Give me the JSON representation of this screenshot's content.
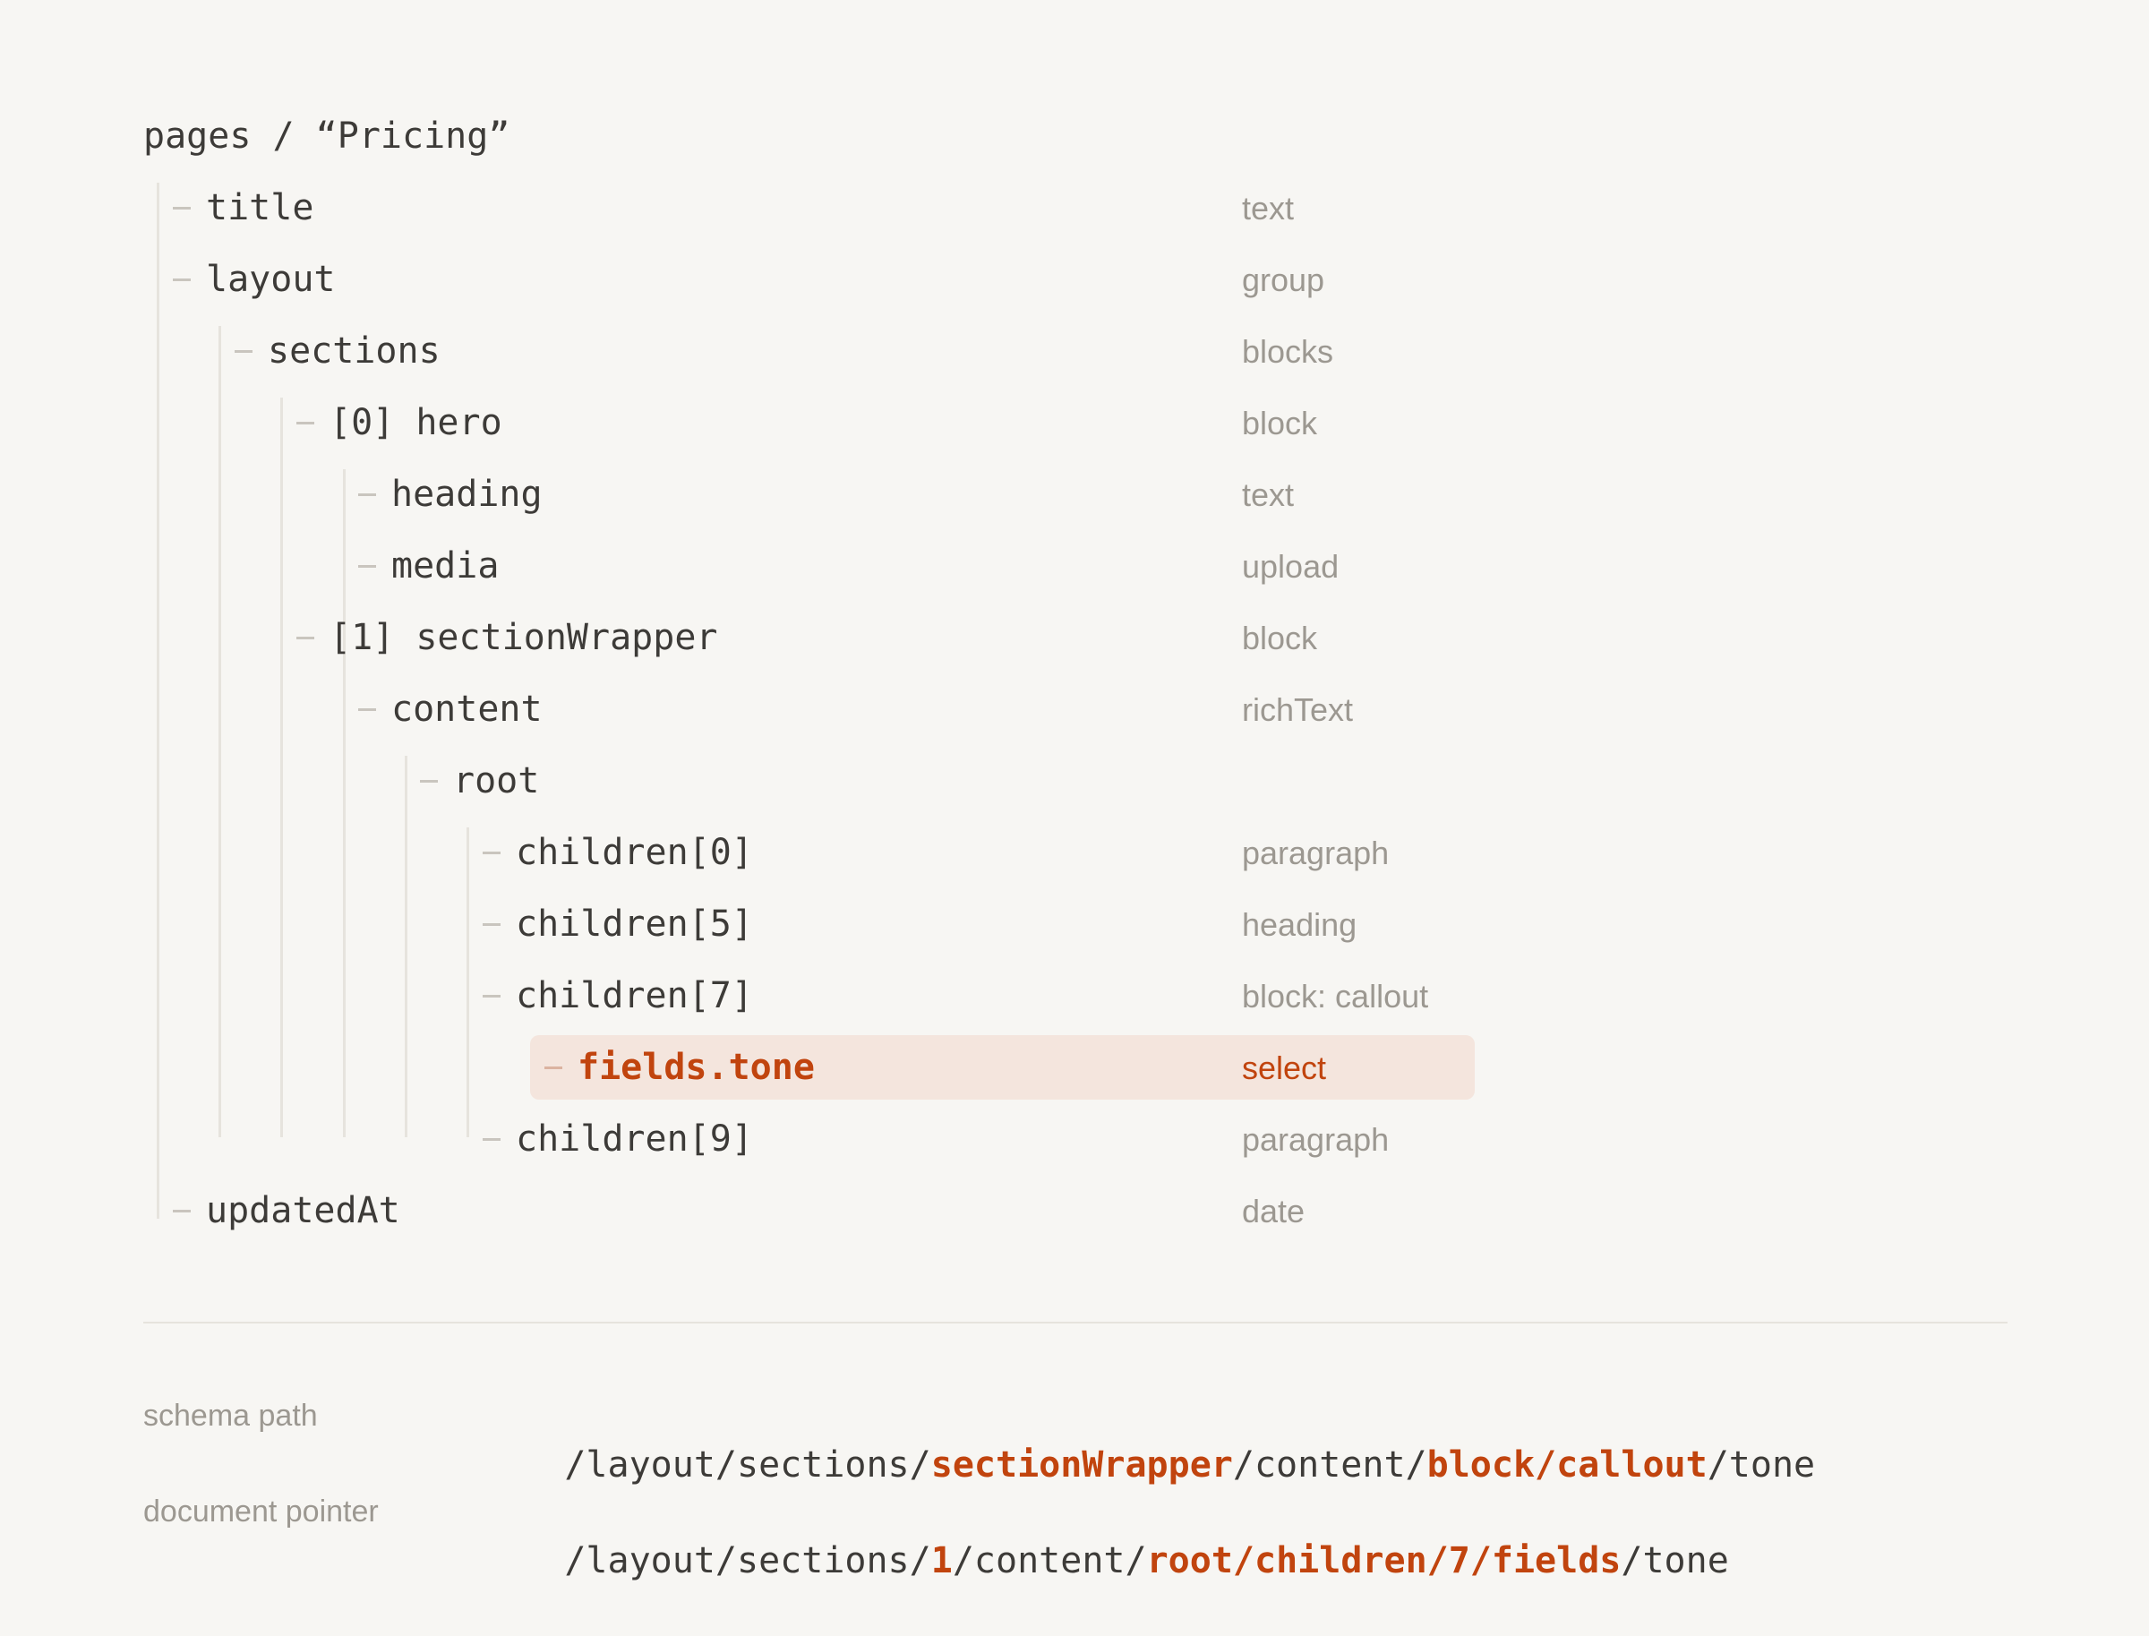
{
  "breadcrumb": "pages / “Pricing”",
  "tree": [
    {
      "label": "title",
      "type": "text"
    },
    {
      "label": "layout",
      "type": "group"
    },
    {
      "label": "sections",
      "type": "blocks"
    },
    {
      "label": "[0] hero",
      "type": "block"
    },
    {
      "label": "heading",
      "type": "text"
    },
    {
      "label": "media",
      "type": "upload"
    },
    {
      "label": "[1] sectionWrapper",
      "type": "block"
    },
    {
      "label": "content",
      "type": "richText"
    },
    {
      "label": "root",
      "type": ""
    },
    {
      "label": "children[0]",
      "type": "paragraph"
    },
    {
      "label": "children[5]",
      "type": "heading"
    },
    {
      "label": "children[7]",
      "type": "block: callout"
    },
    {
      "label": "fields.tone",
      "type": "select",
      "highlighted": true
    },
    {
      "label": "children[9]",
      "type": "paragraph"
    },
    {
      "label": "updatedAt",
      "type": "date"
    }
  ],
  "paths": {
    "schema": {
      "label": "schema path",
      "segments": [
        {
          "text": "/layout/sections/",
          "accent": false
        },
        {
          "text": "sectionWrapper",
          "accent": true
        },
        {
          "text": "/content/",
          "accent": false
        },
        {
          "text": "block/callout",
          "accent": true
        },
        {
          "text": "/tone",
          "accent": false
        }
      ]
    },
    "document": {
      "label": "document pointer",
      "segments": [
        {
          "text": "/layout/sections/",
          "accent": false
        },
        {
          "text": "1",
          "accent": true
        },
        {
          "text": "/content/",
          "accent": false
        },
        {
          "text": "root/children/7/fields",
          "accent": true
        },
        {
          "text": "/tone",
          "accent": false
        }
      ]
    }
  },
  "colors": {
    "background": "#f7f6f3",
    "text": "#3d3b38",
    "muted": "#9c9891",
    "accent": "#c1440e",
    "highlight": "#f4e5dd"
  }
}
